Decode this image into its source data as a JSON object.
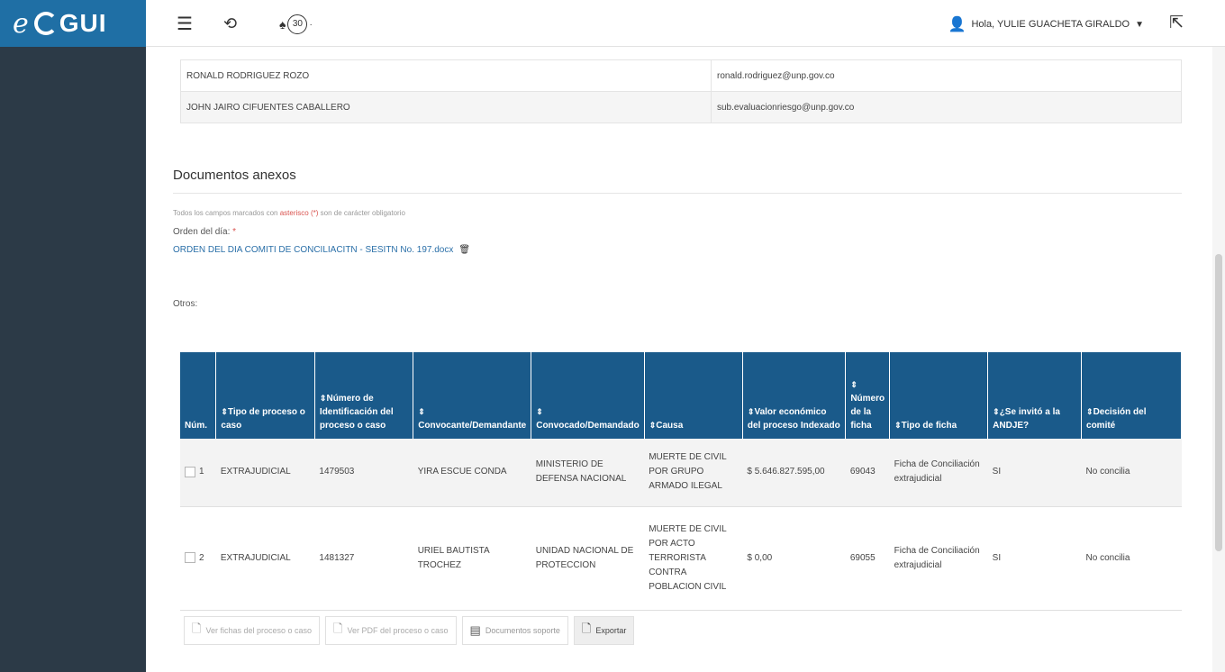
{
  "app": {
    "logo_prefix": "e",
    "logo_name": "GUI"
  },
  "topbar": {
    "notifications": "30",
    "user_greeting": "Hola, YULIE GUACHETA GIRALDO"
  },
  "contacts": [
    {
      "name": "RONALD RODRIGUEZ ROZO",
      "email": "ronald.rodriguez@unp.gov.co"
    },
    {
      "name": "JOHN JAIRO CIFUENTES CABALLERO",
      "email": "sub.evaluacionriesgo@unp.gov.co"
    }
  ],
  "docs": {
    "title": "Documentos anexos",
    "required_note_pre": "Todos los campos marcados con ",
    "required_note_star": "asterisco (*)",
    "required_note_post": " son de carácter obligatorio",
    "orden_label": "Orden del día:",
    "orden_required": "*",
    "orden_file": "ORDEN DEL DIA COMITI DE CONCILIACITN - SESITN No. 197.docx",
    "otros_label": "Otros:"
  },
  "table": {
    "headers": {
      "num": "Núm.",
      "tipo": "Tipo de proceso o caso",
      "numero_id": "Número de Identificación del proceso o caso",
      "convocante": "Convocante/Demandante",
      "convocado": "Convocado/Demandado",
      "causa": "Causa",
      "valor": "Valor económico del proceso Indexado",
      "ficha": "Número de la ficha",
      "tipo_ficha": "Tipo de ficha",
      "andje": "¿Se invitó a la ANDJE?",
      "decision": "Decisión del comité"
    },
    "rows": [
      {
        "num": "1",
        "tipo": "EXTRAJUDICIAL",
        "numero_id": "1479503",
        "convocante": "YIRA ESCUE CONDA",
        "convocado": "MINISTERIO DE DEFENSA NACIONAL",
        "causa": "MUERTE DE CIVIL POR GRUPO ARMADO ILEGAL",
        "valor": "$ 5.646.827.595,00",
        "ficha": "69043",
        "tipo_ficha": "Ficha de Conciliación extrajudicial",
        "andje": "SI",
        "decision": "No concilia"
      },
      {
        "num": "2",
        "tipo": "EXTRAJUDICIAL",
        "numero_id": "1481327",
        "convocante": "URIEL BAUTISTA TROCHEZ",
        "convocado": "UNIDAD NACIONAL DE PROTECCION",
        "causa": "MUERTE DE CIVIL POR ACTO TERRORISTA CONTRA POBLACION CIVIL",
        "valor": "$ 0,00",
        "ficha": "69055",
        "tipo_ficha": "Ficha de Conciliación extrajudicial",
        "andje": "SI",
        "decision": "No concilia"
      }
    ]
  },
  "actions": {
    "ver_fichas": "Ver fichas del proceso o caso",
    "ver_pdf": "Ver PDF del proceso o caso",
    "documentos": "Documentos soporte",
    "exportar": "Exportar"
  }
}
